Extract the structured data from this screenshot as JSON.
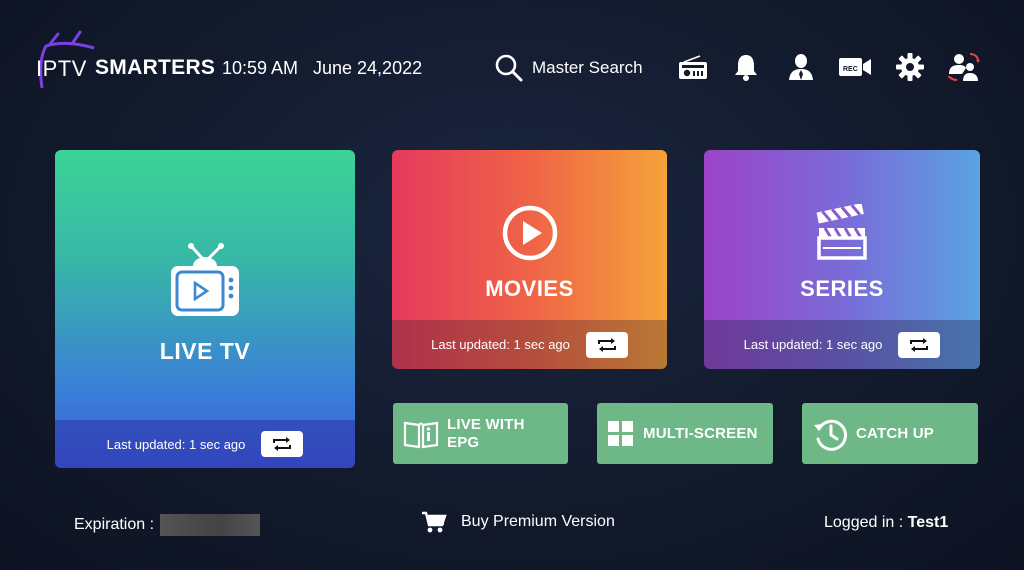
{
  "header": {
    "logo_prefix": "IPTV",
    "logo_brand": "SMARTERS",
    "time": "10:59 AM",
    "date": "June 24,2022",
    "search_label": "Master Search",
    "icons": [
      "radio-icon",
      "bell-icon",
      "user-icon",
      "rec-camera-icon",
      "gear-icon",
      "switch-user-icon"
    ]
  },
  "tiles": {
    "live": {
      "title": "LIVE TV",
      "updated": "Last updated: 1 sec ago"
    },
    "movies": {
      "title": "MOVIES",
      "updated": "Last updated: 1 sec ago"
    },
    "series": {
      "title": "SERIES",
      "updated": "Last updated: 1 sec ago"
    }
  },
  "mini": {
    "epg_line1": "LIVE WITH",
    "epg_line2": "EPG",
    "multi": "MULTI-SCREEN",
    "catch": "CATCH UP"
  },
  "footer": {
    "expiration_label": "Expiration :",
    "buy_label": "Buy Premium Version",
    "logged_label": "Logged in :",
    "username": "Test1"
  },
  "colors": {
    "background": "#121a2c",
    "mini_tile": "#6eb786",
    "logo_accent": "#7b3fe4"
  }
}
